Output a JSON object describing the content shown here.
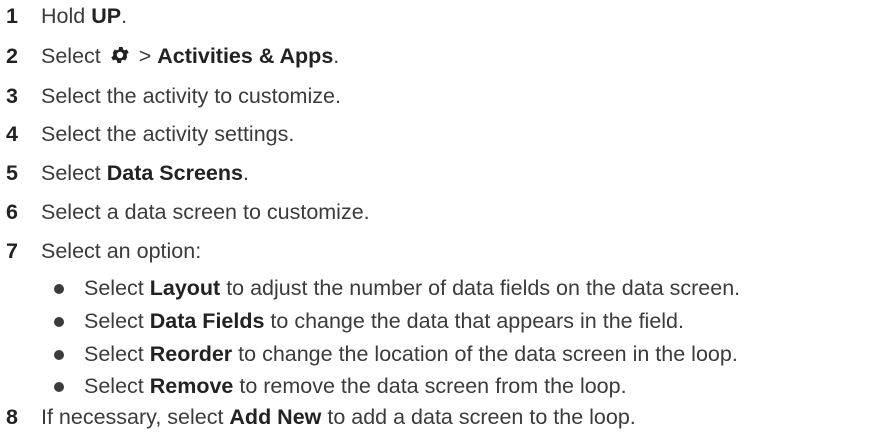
{
  "steps": [
    {
      "num": "1",
      "pre": "Hold ",
      "bold": "UP",
      "post": "."
    },
    {
      "num": "2",
      "pre": "Select ",
      "icon": "gear-icon",
      "mid": " > ",
      "bold": "Activities & Apps",
      "post": "."
    },
    {
      "num": "3",
      "text": "Select the activity to customize."
    },
    {
      "num": "4",
      "text": "Select the activity settings."
    },
    {
      "num": "5",
      "pre": "Select ",
      "bold": "Data Screens",
      "post": "."
    },
    {
      "num": "6",
      "text": "Select a data screen to customize."
    },
    {
      "num": "7",
      "text": "Select an option:",
      "options": [
        {
          "pre": "Select ",
          "bold": "Layout",
          "post": " to adjust the number of data fields on the data screen."
        },
        {
          "pre": "Select ",
          "bold": "Data Fields",
          "post": " to change the data that appears in the field."
        },
        {
          "pre": "Select ",
          "bold": "Reorder",
          "post": " to change the location of the data screen in the loop."
        },
        {
          "pre": "Select ",
          "bold": "Remove",
          "post": " to remove the data screen from the loop."
        }
      ]
    },
    {
      "num": "8",
      "pre": "If necessary, select ",
      "bold": "Add New",
      "post": " to add a data screen to the loop."
    }
  ]
}
